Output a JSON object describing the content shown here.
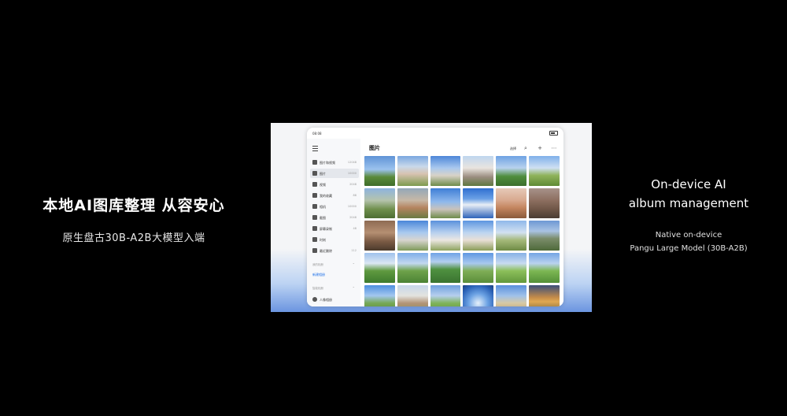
{
  "slide": {
    "headline": "本地AI图库整理 从容安心",
    "subline": "原生盘古30B-A2B大模型入端",
    "en_title_line1": "On-device AI",
    "en_title_line2": "album management",
    "en_sub_line1": "Native on-device",
    "en_sub_line2": "Pangu Large Model (30B-A2B)"
  },
  "tablet": {
    "status": {
      "time": "08:08"
    },
    "sidebar": {
      "items": [
        {
          "label": "图片和视频",
          "count": "12048",
          "icon": "photos-videos-icon"
        },
        {
          "label": "图片",
          "count": "10000",
          "icon": "image-icon",
          "active": true
        },
        {
          "label": "视频",
          "count": "2048",
          "icon": "video-icon"
        },
        {
          "label": "我的收藏",
          "count": "88",
          "icon": "heart-icon"
        },
        {
          "label": "相机",
          "count": "10000",
          "icon": "camera-icon"
        },
        {
          "label": "截图",
          "count": "2048",
          "icon": "screenshot-icon"
        },
        {
          "label": "屏幕录制",
          "count": "48",
          "icon": "screen-record-icon"
        },
        {
          "label": "时刻",
          "count": "",
          "icon": "moments-icon"
        },
        {
          "label": "最近删除",
          "count": "112",
          "icon": "trash-icon"
        }
      ],
      "section1_title": "我的相册",
      "new_album_link": "新建相册",
      "section2_title": "智能相册",
      "portrait_item": {
        "label": "人像相册",
        "icon": "person-icon"
      }
    },
    "content": {
      "title": "图片",
      "select_label": "选择",
      "icons": [
        "search-icon",
        "add-icon",
        "more-icon"
      ]
    },
    "colors": {
      "accent": "#1a6ee8"
    }
  }
}
